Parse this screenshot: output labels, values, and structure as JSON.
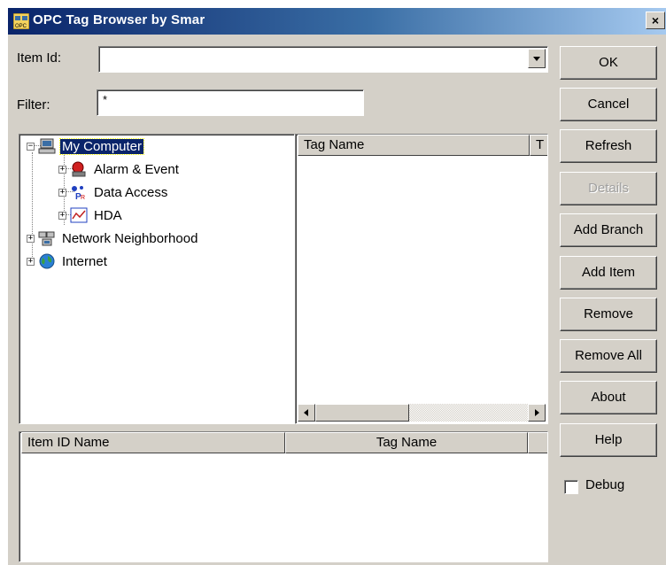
{
  "window": {
    "title": "OPC Tag Browser by Smar",
    "close_glyph": "×"
  },
  "form": {
    "item_id_label": "Item Id:",
    "item_id_value": "",
    "filter_label": "Filter:",
    "filter_value": "*"
  },
  "tree": {
    "items": [
      {
        "label": "My Computer",
        "icon": "computer-icon",
        "expander": "−",
        "selected": true
      },
      {
        "label": "Alarm & Event",
        "icon": "alarm-icon",
        "expander": "+"
      },
      {
        "label": "Data Access",
        "icon": "data-access-icon",
        "expander": "+"
      },
      {
        "label": "HDA",
        "icon": "hda-chart-icon",
        "expander": "+"
      },
      {
        "label": "Network Neighborhood",
        "icon": "network-icon",
        "expander": "+"
      },
      {
        "label": "Internet",
        "icon": "globe-icon",
        "expander": "+"
      }
    ]
  },
  "tag_list": {
    "columns": [
      "Tag Name",
      "T"
    ]
  },
  "items_list": {
    "columns": [
      "Item ID Name",
      "Tag Name",
      ""
    ]
  },
  "buttons": {
    "ok": "OK",
    "cancel": "Cancel",
    "refresh": "Refresh",
    "details": "Details",
    "add_branch": "Add Branch",
    "add_item": "Add Item",
    "remove": "Remove",
    "remove_all": "Remove All",
    "about": "About",
    "help": "Help"
  },
  "debug": {
    "label": "Debug",
    "checked": false
  },
  "colors": {
    "titlebar_start": "#0a246a",
    "titlebar_end": "#a6caf0",
    "selection": "#0a246a",
    "face": "#d4d0c8"
  }
}
